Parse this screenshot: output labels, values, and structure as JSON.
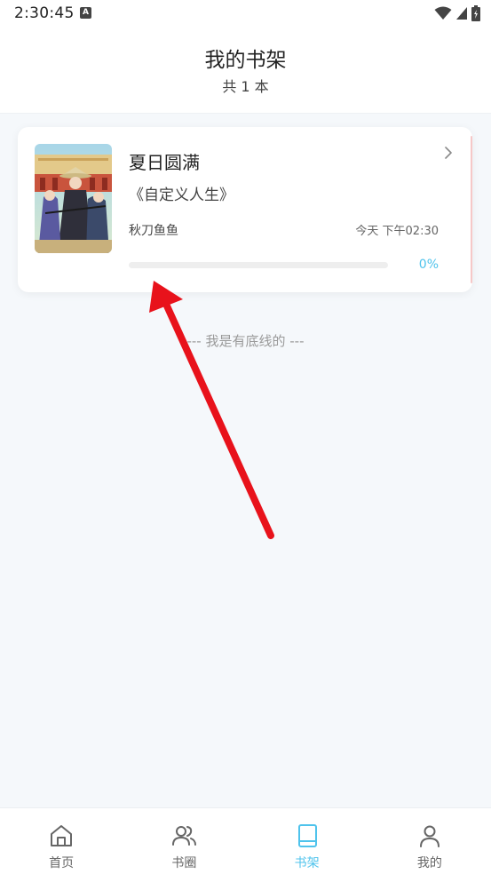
{
  "status_bar": {
    "time": "2:30:45",
    "notification_icon": "a-icon",
    "icons": [
      "wifi-icon",
      "signal-icon",
      "battery-icon"
    ]
  },
  "header": {
    "title": "我的书架",
    "subtitle": "共 1 本"
  },
  "books": [
    {
      "title": "夏日圆满",
      "chapter": "《自定义人生》",
      "author": "秋刀鱼鱼",
      "updated": "今天 下午02:30",
      "progress_percent": 0,
      "progress_text": "0%"
    }
  ],
  "footer_text": "--- 我是有底线的 ---",
  "bottom_nav": {
    "items": [
      {
        "label": "首页",
        "icon": "home-icon",
        "active": false
      },
      {
        "label": "书圈",
        "icon": "users-icon",
        "active": false
      },
      {
        "label": "书架",
        "icon": "book-icon",
        "active": true
      },
      {
        "label": "我的",
        "icon": "user-icon",
        "active": false
      }
    ]
  },
  "colors": {
    "accent": "#4fc3ec",
    "annotation_arrow": "#e8121b",
    "background": "#f5f8fb"
  }
}
